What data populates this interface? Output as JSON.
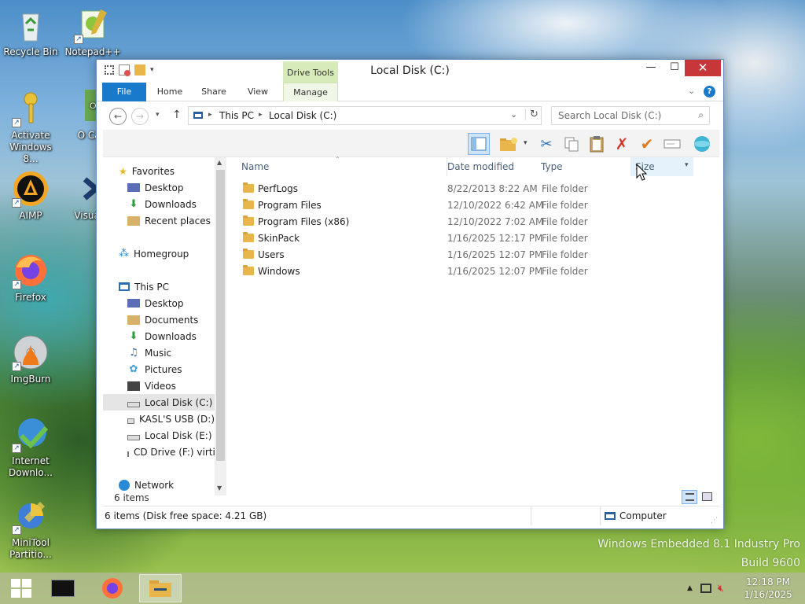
{
  "desktop": {
    "icons": [
      {
        "label": "Recycle Bin"
      },
      {
        "label": "Notepad++"
      },
      {
        "label": "Activate Windows 8..."
      },
      {
        "label": "O Cart"
      },
      {
        "label": "AIMP"
      },
      {
        "label": "Visual S"
      },
      {
        "label": "Firefox"
      },
      {
        "label": "ImgBurn"
      },
      {
        "label": "Internet Downlo..."
      },
      {
        "label": "MiniTool Partitio..."
      }
    ],
    "watermark_line1": "Windows Embedded 8.1 Industry Pro",
    "watermark_line2": "Build 9600"
  },
  "window": {
    "title": "Local Disk (C:)",
    "contextual_group": "Drive Tools",
    "tabs": [
      "File",
      "Home",
      "Share",
      "View",
      "Manage"
    ],
    "breadcrumb": [
      "This PC",
      "Local Disk (C:)"
    ],
    "search_placeholder": "Search Local Disk (C:)",
    "controls": {
      "minimize": "—",
      "maximize": "☐",
      "close": "✕"
    }
  },
  "navpane": {
    "favorites_label": "Favorites",
    "favorites": [
      "Desktop",
      "Downloads",
      "Recent places"
    ],
    "homegroup_label": "Homegroup",
    "thispc_label": "This PC",
    "thispc": [
      "Desktop",
      "Documents",
      "Downloads",
      "Music",
      "Pictures",
      "Videos",
      "Local Disk (C:)",
      "KASL'S USB (D:)",
      "Local Disk (E:)",
      "CD Drive (F:) virti"
    ],
    "network_label": "Network",
    "selected": "Local Disk (C:)"
  },
  "filelist": {
    "columns": [
      "Name",
      "Date modified",
      "Type",
      "Size"
    ],
    "rows": [
      {
        "name": "PerfLogs",
        "date": "8/22/2013 8:22 AM",
        "type": "File folder"
      },
      {
        "name": "Program Files",
        "date": "12/10/2022 6:42 AM",
        "type": "File folder"
      },
      {
        "name": "Program Files (x86)",
        "date": "12/10/2022 7:02 AM",
        "type": "File folder"
      },
      {
        "name": "SkinPack",
        "date": "1/16/2025 12:17 PM",
        "type": "File folder"
      },
      {
        "name": "Users",
        "date": "1/16/2025 12:07 PM",
        "type": "File folder"
      },
      {
        "name": "Windows",
        "date": "1/16/2025 12:07 PM",
        "type": "File folder"
      }
    ],
    "item_count": "6 items"
  },
  "statusbar": {
    "left": "6 items (Disk free space: 4.21 GB)",
    "right": "Computer"
  },
  "taskbar": {
    "time": "12:18 PM",
    "date": "1/16/2025"
  }
}
